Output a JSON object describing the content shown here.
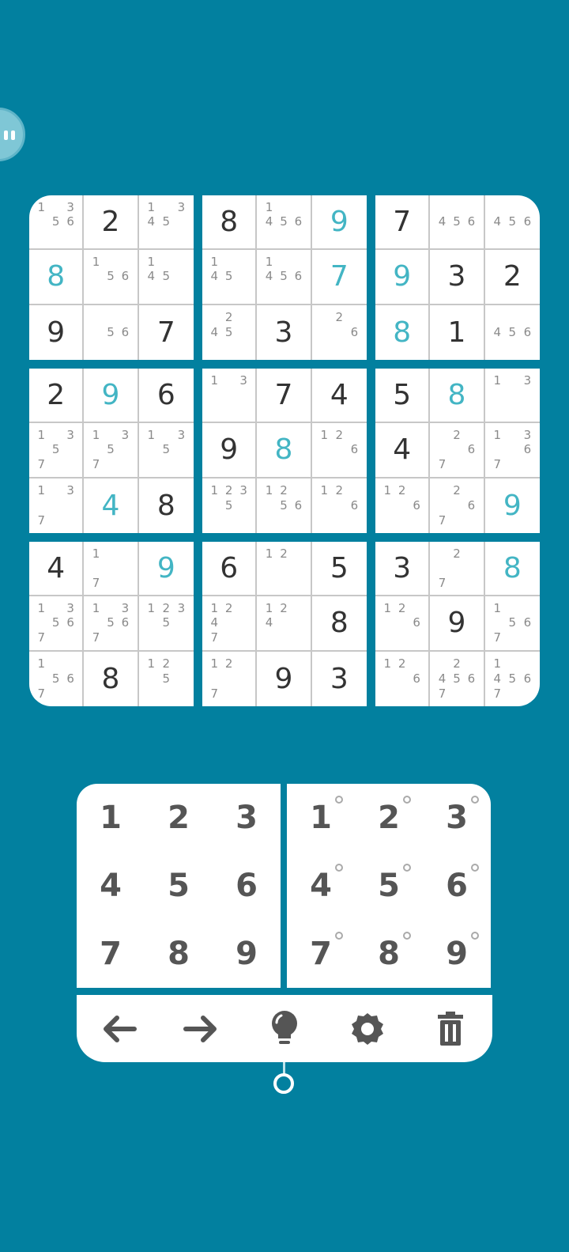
{
  "colors": {
    "background": "#02809f",
    "given_digit": "#333333",
    "user_digit": "#43b5c4",
    "note_digit": "#8a8a8a",
    "board": "#ffffff"
  },
  "grid": [
    [
      {
        "v": "",
        "n": "1356"
      },
      {
        "v": "2"
      },
      {
        "v": "",
        "n": "1345"
      },
      {
        "v": "8"
      },
      {
        "v": "",
        "n": "1456"
      },
      {
        "v": "9",
        "u": true
      },
      {
        "v": "7"
      },
      {
        "v": "",
        "n": "456"
      },
      {
        "v": "",
        "n": "456"
      }
    ],
    [
      {
        "v": "8",
        "u": true
      },
      {
        "v": "",
        "n": "156"
      },
      {
        "v": "",
        "n": "145"
      },
      {
        "v": "",
        "n": "145"
      },
      {
        "v": "",
        "n": "1456"
      },
      {
        "v": "7",
        "u": true
      },
      {
        "v": "9",
        "u": true
      },
      {
        "v": "3"
      },
      {
        "v": "2"
      }
    ],
    [
      {
        "v": "9"
      },
      {
        "v": "",
        "n": "56"
      },
      {
        "v": "7"
      },
      {
        "v": "",
        "n": "245"
      },
      {
        "v": "3"
      },
      {
        "v": "",
        "n": "26"
      },
      {
        "v": "8",
        "u": true
      },
      {
        "v": "1"
      },
      {
        "v": "",
        "n": "456"
      }
    ],
    [
      {
        "v": "2"
      },
      {
        "v": "9",
        "u": true
      },
      {
        "v": "6"
      },
      {
        "v": "",
        "n": "13"
      },
      {
        "v": "7"
      },
      {
        "v": "4"
      },
      {
        "v": "5"
      },
      {
        "v": "8",
        "u": true
      },
      {
        "v": "",
        "n": "13"
      }
    ],
    [
      {
        "v": "",
        "n": "1357"
      },
      {
        "v": "",
        "n": "1357"
      },
      {
        "v": "",
        "n": "135"
      },
      {
        "v": "9"
      },
      {
        "v": "8",
        "u": true
      },
      {
        "v": "",
        "n": "126"
      },
      {
        "v": "4"
      },
      {
        "v": "",
        "n": "267"
      },
      {
        "v": "",
        "n": "1367"
      }
    ],
    [
      {
        "v": "",
        "n": "137"
      },
      {
        "v": "4",
        "u": true
      },
      {
        "v": "8"
      },
      {
        "v": "",
        "n": "1235"
      },
      {
        "v": "",
        "n": "1256"
      },
      {
        "v": "",
        "n": "126"
      },
      {
        "v": "",
        "n": "126"
      },
      {
        "v": "",
        "n": "267"
      },
      {
        "v": "9",
        "u": true
      }
    ],
    [
      {
        "v": "4"
      },
      {
        "v": "",
        "n": "17"
      },
      {
        "v": "9",
        "u": true
      },
      {
        "v": "6"
      },
      {
        "v": "",
        "n": "12"
      },
      {
        "v": "5"
      },
      {
        "v": "3"
      },
      {
        "v": "",
        "n": "27"
      },
      {
        "v": "8",
        "u": true
      }
    ],
    [
      {
        "v": "",
        "n": "13567"
      },
      {
        "v": "",
        "n": "13567"
      },
      {
        "v": "",
        "n": "1235"
      },
      {
        "v": "",
        "n": "1247"
      },
      {
        "v": "",
        "n": "124"
      },
      {
        "v": "8"
      },
      {
        "v": "",
        "n": "126"
      },
      {
        "v": "9"
      },
      {
        "v": "",
        "n": "1567"
      }
    ],
    [
      {
        "v": "",
        "n": "1567"
      },
      {
        "v": "8"
      },
      {
        "v": "",
        "n": "125"
      },
      {
        "v": "",
        "n": "127"
      },
      {
        "v": "9"
      },
      {
        "v": "3"
      },
      {
        "v": "",
        "n": "126"
      },
      {
        "v": "",
        "n": "24567"
      },
      {
        "v": "",
        "n": "14567"
      }
    ]
  ],
  "keypad_numbers": [
    "1",
    "2",
    "3",
    "4",
    "5",
    "6",
    "7",
    "8",
    "9"
  ],
  "keypad_notes": [
    "1",
    "2",
    "3",
    "4",
    "5",
    "6",
    "7",
    "8",
    "9"
  ],
  "toolbar": [
    {
      "name": "undo-button",
      "icon": "arrow-left-icon"
    },
    {
      "name": "redo-button",
      "icon": "arrow-right-icon"
    },
    {
      "name": "hint-button",
      "icon": "lightbulb-icon"
    },
    {
      "name": "settings-button",
      "icon": "gear-icon"
    },
    {
      "name": "clear-button",
      "icon": "trash-icon"
    }
  ]
}
